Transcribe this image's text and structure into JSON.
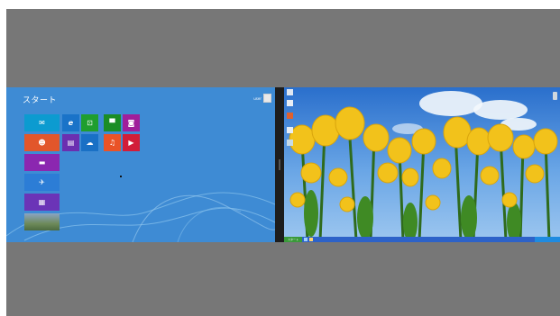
{
  "start": {
    "title": "スタート",
    "user_label": "user",
    "tiles": [
      {
        "name": "mail-tile",
        "icon": "✉",
        "color": "#0c9bd0",
        "label": ""
      },
      {
        "name": "ie-tile",
        "icon": "e",
        "color": "#1a73c8",
        "label": ""
      },
      {
        "name": "store-tile",
        "icon": "⊡",
        "color": "#1f9e2e",
        "label": ""
      },
      {
        "name": "xbox-games-tile",
        "icon": "▀",
        "color": "#1b8d24",
        "label": ""
      },
      {
        "name": "camera-tile",
        "icon": "◙",
        "color": "#a01e9a",
        "label": ""
      },
      {
        "name": "people-tile",
        "icon": "☻",
        "color": "#e2562b",
        "label": ""
      },
      {
        "name": "news-tile",
        "icon": "▤",
        "color": "#6b2fb0",
        "label": ""
      },
      {
        "name": "skydrive-tile",
        "icon": "☁",
        "color": "#1970c5",
        "label": ""
      },
      {
        "name": "music-tile",
        "icon": "♫",
        "color": "#ea5327",
        "label": ""
      },
      {
        "name": "video-tile",
        "icon": "▶",
        "color": "#d21d39",
        "label": ""
      },
      {
        "name": "messaging-tile",
        "icon": "▬",
        "color": "#8b27b0",
        "label": ""
      },
      {
        "name": "maps-tile",
        "icon": "✈",
        "color": "#2c7dd6",
        "label": ""
      },
      {
        "name": "photos-tile",
        "icon": "▦",
        "color": "#6b34b7",
        "label": ""
      },
      {
        "name": "desktop-tile",
        "icon": "",
        "color": "#5a7a5a",
        "label": ""
      }
    ]
  },
  "desktop": {
    "start_label": "スタート"
  },
  "colors": {
    "frame": "#777777",
    "start_bg": "#3e8bd4",
    "divider": "#1d1d1d",
    "taskbar": "#2d62c8"
  }
}
